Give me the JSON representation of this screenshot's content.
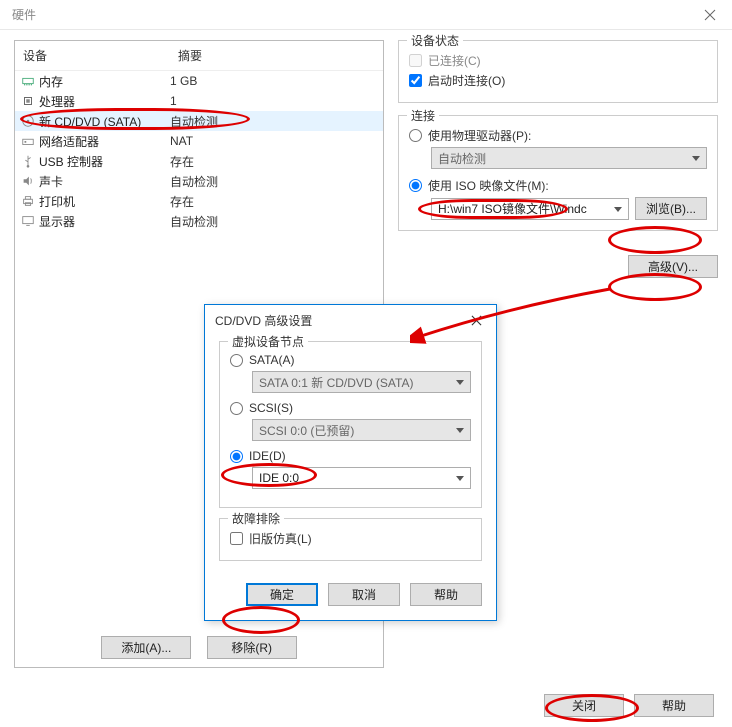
{
  "window": {
    "title": "硬件"
  },
  "deviceTable": {
    "headers": {
      "name": "设备",
      "summary": "摘要"
    },
    "rows": [
      {
        "name": "内存",
        "summary": "1 GB",
        "icon": "memory"
      },
      {
        "name": "处理器",
        "summary": "1",
        "icon": "cpu"
      },
      {
        "name": "新 CD/DVD (SATA)",
        "summary": "自动检测",
        "icon": "disc",
        "selected": true
      },
      {
        "name": "网络适配器",
        "summary": "NAT",
        "icon": "nic"
      },
      {
        "name": "USB 控制器",
        "summary": "存在",
        "icon": "usb"
      },
      {
        "name": "声卡",
        "summary": "自动检测",
        "icon": "sound"
      },
      {
        "name": "打印机",
        "summary": "存在",
        "icon": "printer"
      },
      {
        "name": "显示器",
        "summary": "自动检测",
        "icon": "display"
      }
    ]
  },
  "deviceStatus": {
    "legend": "设备状态",
    "connected": "已连接(C)",
    "connectAtPowerOn": "启动时连接(O)"
  },
  "connection": {
    "legend": "连接",
    "usePhysical": "使用物理驱动器(P):",
    "autoDetect": "自动检测",
    "useISO": "使用 ISO 映像文件(M):",
    "isoPath": "H:\\win7 ISO镜像文件\\Windc",
    "browse": "浏览(B)..."
  },
  "advancedButton": "高级(V)...",
  "leftButtons": {
    "add": "添加(A)...",
    "remove": "移除(R)"
  },
  "modal": {
    "title": "CD/DVD 高级设置",
    "nodeLegend": "虚拟设备节点",
    "sataLabel": "SATA(A)",
    "sataValue": "SATA 0:1   新 CD/DVD (SATA)",
    "scsiLabel": "SCSI(S)",
    "scsiValue": "SCSI 0:0   (已预留)",
    "ideLabel": "IDE(D)",
    "ideValue": "IDE 0:0",
    "troubleLegend": "故障排除",
    "legacyEmu": "旧版仿真(L)",
    "ok": "确定",
    "cancel": "取消",
    "help": "帮助"
  },
  "footer": {
    "close": "关闭",
    "help": "帮助"
  }
}
